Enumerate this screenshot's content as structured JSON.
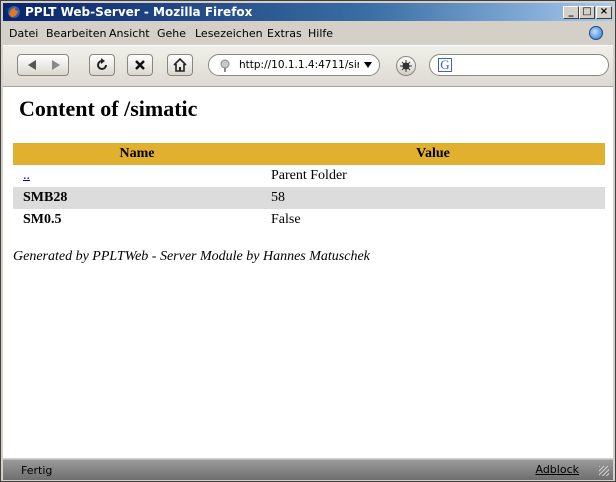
{
  "window": {
    "title": "PPLT Web-Server - Mozilla Firefox"
  },
  "menu": {
    "items": [
      {
        "label": "Datei"
      },
      {
        "label": "Bearbeiten"
      },
      {
        "label": "Ansicht"
      },
      {
        "label": "Gehe"
      },
      {
        "label": "Lesezeichen"
      },
      {
        "label": "Extras"
      },
      {
        "label": "Hilfe"
      }
    ]
  },
  "toolbar": {
    "icons": [
      "back-icon",
      "forward-icon",
      "reload-icon",
      "stop-icon",
      "home-icon"
    ],
    "url": "http://10.1.1.4:4711/sir",
    "search_placeholder": ""
  },
  "page": {
    "heading": "Content of /simatic",
    "table": {
      "headers": {
        "name": "Name",
        "value": "Value"
      },
      "rows": [
        {
          "name": "..",
          "value": "Parent Folder"
        },
        {
          "name": "SMB28",
          "value": "58"
        },
        {
          "name": "SM0.5",
          "value": "False"
        }
      ]
    },
    "footer": "Generated by PPLTWeb - Server Module by Hannes Matuschek"
  },
  "statusbar": {
    "status": "Fertig",
    "adblock": "Adblock"
  },
  "colors": {
    "table_header": "#e1b02f",
    "row_alt": "#dcdcdc",
    "titlebar": "#0a246a"
  }
}
